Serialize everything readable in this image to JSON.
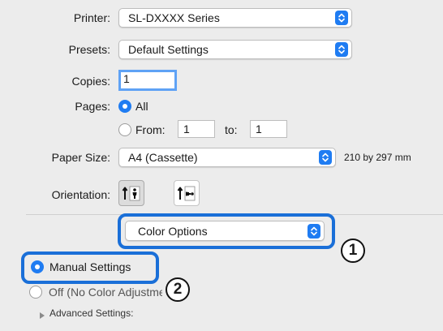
{
  "printer": {
    "label": "Printer:",
    "value": "SL-DXXXX Series"
  },
  "presets": {
    "label": "Presets:",
    "value": "Default Settings"
  },
  "copies": {
    "label": "Copies:",
    "value": "1"
  },
  "pages": {
    "label": "Pages:",
    "all_label": "All",
    "from_label": "From:",
    "from_value": "1",
    "to_label": "to:",
    "to_value": "1"
  },
  "paper_size": {
    "label": "Paper Size:",
    "value": "A4 (Cassette)",
    "dimensions": "210 by 297 mm"
  },
  "orientation": {
    "label": "Orientation:"
  },
  "section_popup": {
    "value": "Color Options"
  },
  "color": {
    "manual_label": "Manual Settings",
    "off_label": "Off (No Color Adjustment)"
  },
  "advanced": {
    "label": "Advanced Settings:"
  },
  "callouts": {
    "one": "1",
    "two": "2"
  },
  "colors": {
    "accent": "#1f7cf2",
    "highlight": "#1a6fd8",
    "background": "#ececec"
  }
}
